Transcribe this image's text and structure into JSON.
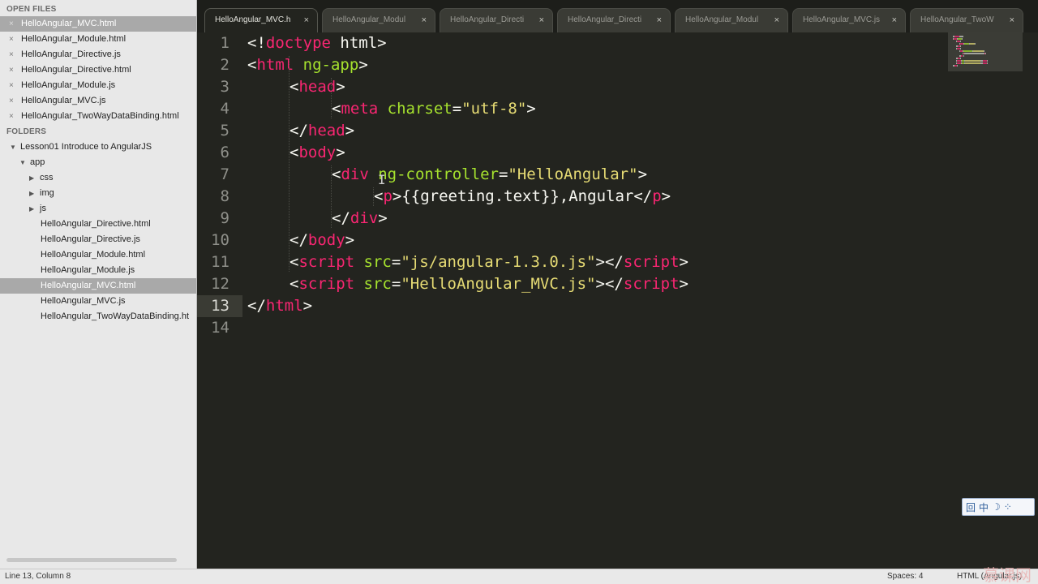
{
  "sidebar": {
    "open_files_header": "OPEN FILES",
    "folders_header": "FOLDERS",
    "open_files": [
      {
        "label": "HelloAngular_MVC.html",
        "selected": true
      },
      {
        "label": "HelloAngular_Module.html",
        "selected": false
      },
      {
        "label": "HelloAngular_Directive.js",
        "selected": false
      },
      {
        "label": "HelloAngular_Directive.html",
        "selected": false
      },
      {
        "label": "HelloAngular_Module.js",
        "selected": false
      },
      {
        "label": "HelloAngular_MVC.js",
        "selected": false
      },
      {
        "label": "HelloAngular_TwoWayDataBinding.html",
        "selected": false
      }
    ],
    "tree": [
      {
        "label": "Lesson01 Introduce to AngularJS",
        "depth": 0,
        "arrow": "down",
        "selected": false
      },
      {
        "label": "app",
        "depth": 1,
        "arrow": "down",
        "selected": false
      },
      {
        "label": "css",
        "depth": 2,
        "arrow": "right",
        "selected": false
      },
      {
        "label": "img",
        "depth": 2,
        "arrow": "right",
        "selected": false
      },
      {
        "label": "js",
        "depth": 2,
        "arrow": "right",
        "selected": false
      },
      {
        "label": "HelloAngular_Directive.html",
        "depth": 2,
        "arrow": "none",
        "selected": false
      },
      {
        "label": "HelloAngular_Directive.js",
        "depth": 2,
        "arrow": "none",
        "selected": false
      },
      {
        "label": "HelloAngular_Module.html",
        "depth": 2,
        "arrow": "none",
        "selected": false
      },
      {
        "label": "HelloAngular_Module.js",
        "depth": 2,
        "arrow": "none",
        "selected": false
      },
      {
        "label": "HelloAngular_MVC.html",
        "depth": 2,
        "arrow": "none",
        "selected": true
      },
      {
        "label": "HelloAngular_MVC.js",
        "depth": 2,
        "arrow": "none",
        "selected": false
      },
      {
        "label": "HelloAngular_TwoWayDataBinding.ht",
        "depth": 2,
        "arrow": "none",
        "selected": false
      }
    ]
  },
  "tabs": [
    {
      "label": "HelloAngular_MVC.h",
      "active": true
    },
    {
      "label": "HelloAngular_Modul",
      "active": false
    },
    {
      "label": "HelloAngular_Directi",
      "active": false
    },
    {
      "label": "HelloAngular_Directi",
      "active": false
    },
    {
      "label": "HelloAngular_Modul",
      "active": false
    },
    {
      "label": "HelloAngular_MVC.js",
      "active": false
    },
    {
      "label": "HelloAngular_TwoW",
      "active": false
    }
  ],
  "tab_close_glyph": "×",
  "file_close_glyph": "×",
  "editor": {
    "current_line": 13,
    "lines": [
      {
        "n": "1",
        "indent": 0,
        "tokens": [
          [
            "p",
            "<!"
          ],
          [
            "t",
            "doctype"
          ],
          [
            "p",
            " html>"
          ]
        ]
      },
      {
        "n": "2",
        "indent": 0,
        "tokens": [
          [
            "p",
            "<"
          ],
          [
            "t",
            "html"
          ],
          [
            "p",
            " "
          ],
          [
            "a",
            "ng-app"
          ],
          [
            "p",
            ">"
          ]
        ]
      },
      {
        "n": "3",
        "indent": 1,
        "tokens": [
          [
            "p",
            "<"
          ],
          [
            "t",
            "head"
          ],
          [
            "p",
            ">"
          ]
        ]
      },
      {
        "n": "4",
        "indent": 2,
        "tokens": [
          [
            "p",
            "<"
          ],
          [
            "t",
            "meta"
          ],
          [
            "p",
            " "
          ],
          [
            "a",
            "charset"
          ],
          [
            "p",
            "="
          ],
          [
            "s",
            "\"utf-8\""
          ],
          [
            "p",
            ">"
          ]
        ]
      },
      {
        "n": "5",
        "indent": 1,
        "tokens": [
          [
            "p",
            "</"
          ],
          [
            "t",
            "head"
          ],
          [
            "p",
            ">"
          ]
        ]
      },
      {
        "n": "6",
        "indent": 1,
        "tokens": [
          [
            "p",
            "<"
          ],
          [
            "t",
            "body"
          ],
          [
            "p",
            ">"
          ]
        ]
      },
      {
        "n": "7",
        "indent": 2,
        "tokens": [
          [
            "p",
            "<"
          ],
          [
            "t",
            "div"
          ],
          [
            "p",
            " "
          ],
          [
            "a",
            "ng-controller"
          ],
          [
            "p",
            "="
          ],
          [
            "s",
            "\"HelloAngular\""
          ],
          [
            "p",
            ">"
          ]
        ]
      },
      {
        "n": "8",
        "indent": 3,
        "tokens": [
          [
            "p",
            "<"
          ],
          [
            "t",
            "p"
          ],
          [
            "p",
            ">{{greeting.text}},Angular</"
          ],
          [
            "t",
            "p"
          ],
          [
            "p",
            ">"
          ]
        ]
      },
      {
        "n": "9",
        "indent": 2,
        "tokens": [
          [
            "p",
            "</"
          ],
          [
            "t",
            "div"
          ],
          [
            "p",
            ">"
          ]
        ]
      },
      {
        "n": "10",
        "indent": 1,
        "tokens": [
          [
            "p",
            "</"
          ],
          [
            "t",
            "body"
          ],
          [
            "p",
            ">"
          ]
        ]
      },
      {
        "n": "11",
        "indent": 1,
        "tokens": [
          [
            "p",
            "<"
          ],
          [
            "t",
            "script"
          ],
          [
            "p",
            " "
          ],
          [
            "a",
            "src"
          ],
          [
            "p",
            "="
          ],
          [
            "s",
            "\"js/angular-1.3.0.js\""
          ],
          [
            "p",
            "></"
          ],
          [
            "t",
            "script"
          ],
          [
            "p",
            ">"
          ]
        ]
      },
      {
        "n": "12",
        "indent": 1,
        "tokens": [
          [
            "p",
            "<"
          ],
          [
            "t",
            "script"
          ],
          [
            "p",
            " "
          ],
          [
            "a",
            "src"
          ],
          [
            "p",
            "="
          ],
          [
            "s",
            "\"HelloAngular_MVC.js\""
          ],
          [
            "p",
            "></"
          ],
          [
            "t",
            "script"
          ],
          [
            "p",
            ">"
          ]
        ]
      },
      {
        "n": "13",
        "indent": 0,
        "tokens": [
          [
            "p",
            "</"
          ],
          [
            "t",
            "html"
          ],
          [
            "p",
            ">"
          ]
        ]
      },
      {
        "n": "14",
        "indent": 0,
        "tokens": []
      }
    ]
  },
  "ime": {
    "items": [
      "回",
      "中",
      "☽",
      "⁘"
    ]
  },
  "status": {
    "position": "Line 13, Column 8",
    "spaces": "Spaces: 4",
    "syntax": "HTML (Angular.js)",
    "watermark": "慕课网"
  },
  "colors": {
    "editor_bg": "#23241f",
    "tag": "#f92672",
    "attr": "#a6e22e",
    "string": "#e6db74",
    "plain": "#f8f8f2",
    "sidebar_bg": "#e8e8e8",
    "sidebar_selected": "#a9a9a9"
  }
}
